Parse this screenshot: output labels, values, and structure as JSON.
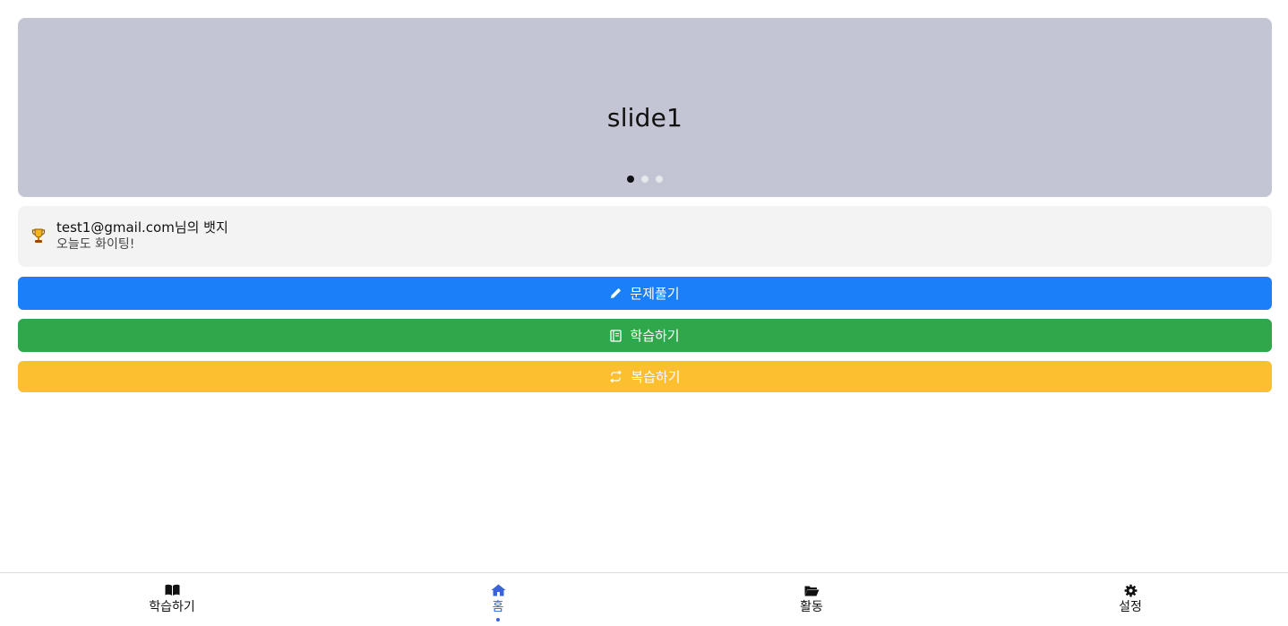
{
  "carousel": {
    "slide_text": "slide1",
    "slide_count": 3,
    "active_index": 0
  },
  "badge": {
    "title": "test1@gmail.com님의 뱃지",
    "subtitle": "오늘도 화이팅!",
    "icon": "trophy-icon"
  },
  "actions": {
    "solve_label": "문제풀기",
    "study_label": "학습하기",
    "review_label": "복습하기",
    "solve_color": "#1a7ff8",
    "study_color": "#2fa74a",
    "review_color": "#fcbf2f"
  },
  "nav": {
    "items": [
      {
        "label": "학습하기",
        "icon": "book-open-icon"
      },
      {
        "label": "홈",
        "icon": "home-icon",
        "active": true
      },
      {
        "label": "활동",
        "icon": "folder-open-icon"
      },
      {
        "label": "설정",
        "icon": "gear-icon"
      }
    ],
    "active_color": "#3a63d8"
  }
}
